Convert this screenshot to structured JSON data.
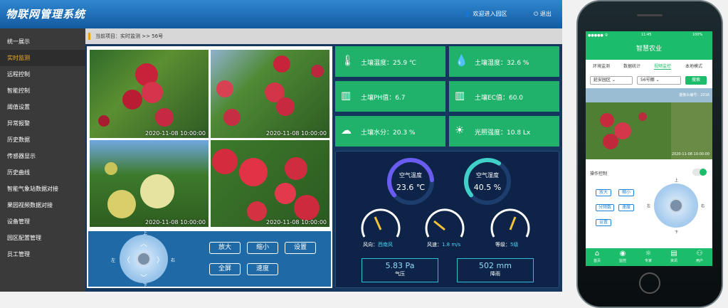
{
  "header": {
    "title": "物联网管理系统",
    "welcome": "欢迎进入园区",
    "logout": "退出"
  },
  "sidebar": {
    "items": [
      "统一展示",
      "实时监测",
      "远程控制",
      "智能控制",
      "阈值设置",
      "异常报警",
      "历史数据",
      "传感器显示",
      "历史曲线",
      "智能气象站数据对接",
      "果园视频数据对接",
      "设备管理",
      "园区配置管理",
      "员工管理"
    ],
    "active_index": 1
  },
  "breadcrumb": "当前项目：实时监测  >>  56号",
  "video": {
    "timestamps": [
      "2020-11-08 10:00:00",
      "2020-11-08 10:00:00",
      "2020-11-08 10:00:00",
      "2020-11-08 10:00:00"
    ]
  },
  "control": {
    "up": "上",
    "down": "下",
    "left": "左",
    "right": "右",
    "buttons": [
      "放大",
      "缩小",
      "设置",
      "全屏",
      "速度"
    ]
  },
  "sensors": [
    {
      "label": "土壤温度：25.9 ℃",
      "icon": "thermometer-icon",
      "glyph": "🌡"
    },
    {
      "label": "土壤湿度：32.6 %",
      "icon": "droplet-icon",
      "glyph": "💧"
    },
    {
      "label": "土壤PH值：6.7",
      "icon": "ph-gauge-icon",
      "glyph": "▥"
    },
    {
      "label": "土壤EC值：60.0",
      "icon": "ec-gauge-icon",
      "glyph": "▥"
    },
    {
      "label": "土壤水分：20.3 %",
      "icon": "rain-cloud-icon",
      "glyph": "☁"
    },
    {
      "label": "光照强度：10.8 Lx",
      "icon": "sun-icon",
      "glyph": "☀"
    }
  ],
  "air": {
    "temp": {
      "label": "空气温度",
      "value": "23.6 ℃",
      "level": 0.6
    },
    "humidity": {
      "label": "空气湿度",
      "value": "40.5 %",
      "level": 0.45
    },
    "wind_dir": {
      "label": "风向：",
      "value": "西南风"
    },
    "wind_speed": {
      "label": "风速：",
      "value": "1.8 m/s"
    },
    "grade": {
      "label": "等级：",
      "value": "5级"
    },
    "pressure": {
      "value": "5.83 Pa",
      "label": "气压"
    },
    "rain": {
      "value": "502 mm",
      "label": "降雨"
    }
  },
  "phone": {
    "status": {
      "carrier": "●●●●● 令",
      "time": "11:45",
      "battery": "100%"
    },
    "title": "智慧农业",
    "tabs": [
      "环境监测",
      "数据统计",
      "视频监控",
      "本地模式"
    ],
    "active_tab": 2,
    "select1": "延安园区",
    "select2": "56号棚",
    "search": "搜索",
    "cam_label": "摄像头编号：2016",
    "cam_time": "2020-11-08 10:00:00",
    "op_label": "操作控制",
    "buttons": [
      "放大",
      "缩小",
      "分频数",
      "速度",
      "设置"
    ],
    "dirs": {
      "up": "上",
      "down": "下",
      "left": "左",
      "right": "右"
    },
    "nav": [
      "首页",
      "监控",
      "专家",
      "资讯",
      "用户"
    ]
  },
  "colors": {
    "accent": "#1bbd6a",
    "header": "#1e6fb8",
    "active_menu": "#f4b12c"
  }
}
